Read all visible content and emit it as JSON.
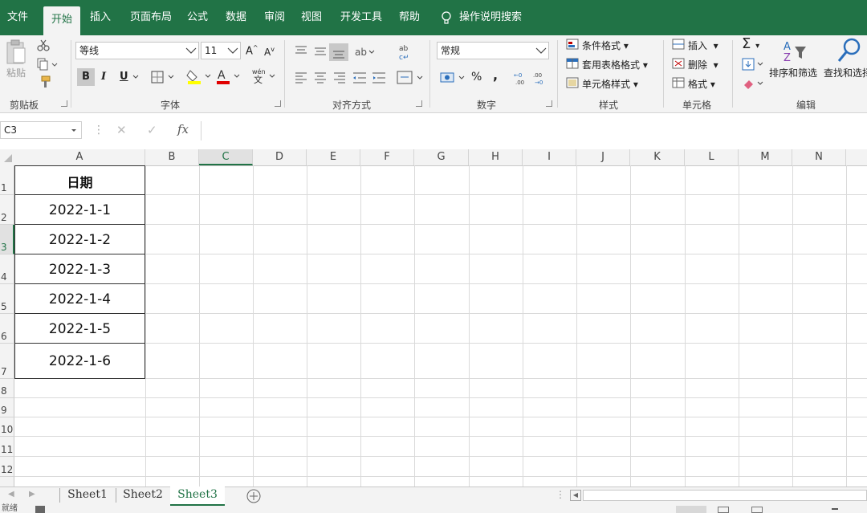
{
  "tabs": [
    {
      "label": "文件"
    },
    {
      "label": "开始"
    },
    {
      "label": "插入"
    },
    {
      "label": "页面布局"
    },
    {
      "label": "公式"
    },
    {
      "label": "数据"
    },
    {
      "label": "审阅"
    },
    {
      "label": "视图"
    },
    {
      "label": "开发工具"
    },
    {
      "label": "帮助"
    }
  ],
  "active_tab": "开始",
  "tell_me": "操作说明搜索",
  "ribbon": {
    "clipboard": {
      "paste": "粘贴",
      "group": "剪贴板"
    },
    "font": {
      "name": "等线",
      "size": "11",
      "bold": "B",
      "italic": "I",
      "underline": "U",
      "group": "字体"
    },
    "alignment": {
      "group": "对齐方式"
    },
    "number": {
      "format": "常规",
      "percent": "%",
      "comma": ",",
      "group": "数字"
    },
    "styles": {
      "conditional": "条件格式",
      "table": "套用表格格式",
      "cell": "单元格样式",
      "group": "样式"
    },
    "cells": {
      "insert": "插入",
      "delete": "删除",
      "format": "格式",
      "group": "单元格"
    },
    "editing": {
      "sort": "排序和筛选",
      "find": "查找和选择",
      "group": "编辑"
    }
  },
  "formula_bar": {
    "name_box": "C3",
    "fx": "fx",
    "value": ""
  },
  "columns": [
    "A",
    "B",
    "C",
    "D",
    "E",
    "F",
    "G",
    "H",
    "I",
    "J",
    "K",
    "L",
    "M",
    "N"
  ],
  "rows": [
    "1",
    "2",
    "3",
    "4",
    "5",
    "6",
    "7",
    "8",
    "9",
    "10",
    "11",
    "12"
  ],
  "cells": {
    "A1": "日期",
    "A2": "2022-1-1",
    "A3": "2022-1-2",
    "A4": "2022-1-3",
    "A5": "2022-1-4",
    "A6": "2022-1-5",
    "A7": "2022-1-6"
  },
  "sheets": [
    {
      "label": "Sheet1"
    },
    {
      "label": "Sheet2"
    },
    {
      "label": "Sheet3"
    }
  ],
  "active_sheet": "Sheet3",
  "status": {
    "ready": "就绪"
  },
  "colors": {
    "brand": "#217346",
    "ribbon_bg": "#f3f3f3",
    "grid": "#dadada"
  }
}
